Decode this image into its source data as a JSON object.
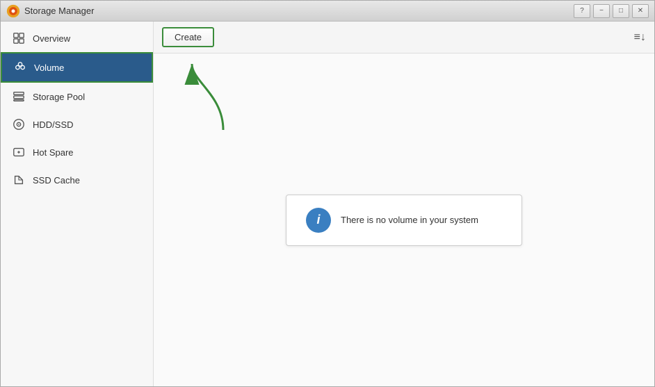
{
  "window": {
    "title": "Storage Manager"
  },
  "titlebar": {
    "minimize_label": "−",
    "restore_label": "□",
    "close_label": "✕",
    "question_label": "?"
  },
  "sidebar": {
    "items": [
      {
        "id": "overview",
        "label": "Overview",
        "active": false
      },
      {
        "id": "volume",
        "label": "Volume",
        "active": true
      },
      {
        "id": "storage-pool",
        "label": "Storage Pool",
        "active": false
      },
      {
        "id": "hdd-ssd",
        "label": "HDD/SSD",
        "active": false
      },
      {
        "id": "hot-spare",
        "label": "Hot Spare",
        "active": false
      },
      {
        "id": "ssd-cache",
        "label": "SSD Cache",
        "active": false
      }
    ]
  },
  "toolbar": {
    "create_label": "Create"
  },
  "content": {
    "empty_message": "There is no volume in your system"
  }
}
